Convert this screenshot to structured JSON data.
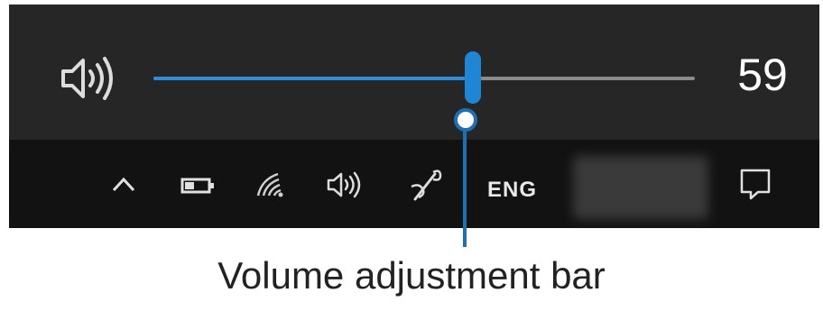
{
  "volume_flyout": {
    "icon": "speaker-icon",
    "value_label": "59",
    "level_percent": 59
  },
  "taskbar": {
    "tray_icons": [
      "chevron-up-icon",
      "battery-icon",
      "wifi-icon",
      "speaker-icon",
      "pen-icon"
    ],
    "language": "ENG",
    "notification_icon": "action-center-icon"
  },
  "callout": {
    "label": "Volume adjustment bar"
  },
  "colors": {
    "accent": "#1f86d6",
    "callout": "#1f6fb6",
    "flyout_background": "#262626",
    "taskbar_background": "#121212"
  }
}
